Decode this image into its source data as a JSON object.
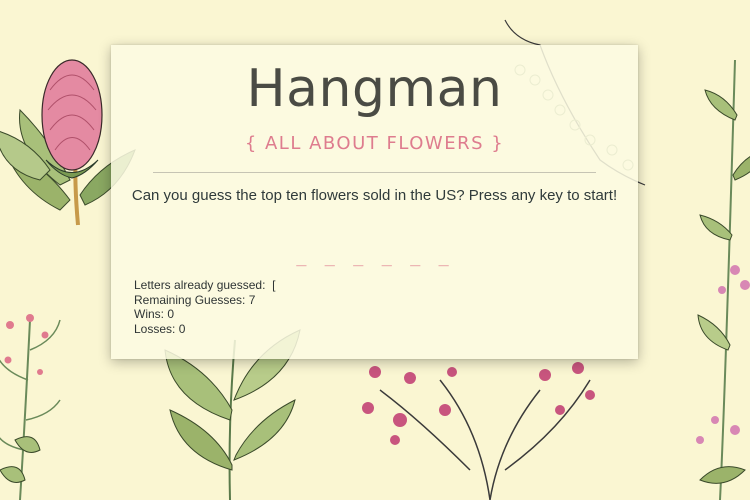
{
  "game": {
    "title": "Hangman",
    "subtitle": "{ ALL ABOUT FLOWERS }",
    "prompt": "Can you guess the top ten flowers sold in the US? Press any key to start!",
    "word_blanks": "_ _ _ _ _ _",
    "stats": {
      "letters_guessed": "Letters already guessed:  [",
      "remaining": "Remaining Guesses: 7",
      "wins": "Wins: 0",
      "losses": "Losses: 0"
    }
  },
  "colors": {
    "background": "#faf6d2",
    "accent_pink": "#de7c8e",
    "title_gray": "#4a4b44",
    "card": "#fbfae2"
  }
}
